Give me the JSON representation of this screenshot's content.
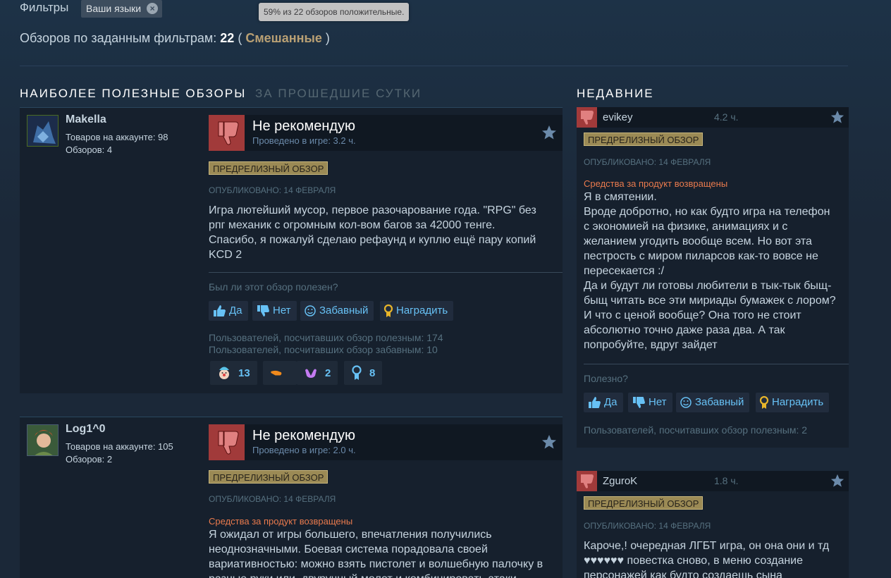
{
  "filters": {
    "label": "Фильтры",
    "chip_label": "Ваши языки",
    "chip_close_glyph": "×"
  },
  "tooltip": "59% из 22 обзоров положительные.",
  "summary": {
    "prefix": "Обзоров по заданным фильтрам:",
    "count": "22",
    "open_paren": "(",
    "rating": "Смешанные",
    "close_paren": ")"
  },
  "sections": {
    "helpful_title": "Наиболее полезные обзоры",
    "helpful_period": "за прошедшие сутки",
    "recent_title": "Недавние"
  },
  "colors": {
    "background": "#1b2838",
    "accent_link": "#67c1f5",
    "negative": "#a13a3a",
    "prerelease_badge": "#9b8a55",
    "refund_text": "#e97a4d",
    "mixed_rating": "#b9a074"
  },
  "reviews": [
    {
      "author": "Makella",
      "products": "Товаров на аккаунте: 98",
      "reviews_count": "Обзоров: 4",
      "verdict": "Не рекомендую",
      "hours": "Проведено в игре: 3.2 ч.",
      "badge": "Предрелизный обзор",
      "posted": "Опубликовано: 14 февраля",
      "text": [
        "Игра лютейший мусор, первое разочарование года. \"RPG\" без",
        "рпг механик с огромным кол-вом багов за 42000 тенге.",
        "Спасибо, я пожалуй сделаю рефаунд и куплю ещё пару копий",
        "KCD 2"
      ],
      "helpful_question": "Был ли этот обзор полезен?",
      "buttons": {
        "yes": "Да",
        "no": "Нет",
        "funny": "Забавный",
        "award": "Наградить"
      },
      "helpful_count": "Пользователей, посчитавших обзор полезным: 174",
      "funny_count": "Пользователей, посчитавших обзор забавным: 10",
      "awards": [
        {
          "icon": "clown-face-icon",
          "count": "13"
        },
        {
          "icon": "boot-icon",
          "count": ""
        },
        {
          "icon": "heart-hands-icon",
          "count": "2"
        },
        {
          "icon": "medal-icon",
          "count": "8"
        }
      ]
    },
    {
      "author": "Log1^0",
      "products": "Товаров на аккаунте: 105",
      "reviews_count": "Обзоров: 2",
      "verdict": "Не рекомендую",
      "hours": "Проведено в игре: 2.0 ч.",
      "badge": "Предрелизный обзор",
      "posted": "Опубликовано: 14 февраля",
      "refund": "Средства за продукт возвращены",
      "text": [
        "Я ожидал от игры большего, впечатления получились",
        "неоднозначными. Боевая система порадовала своей",
        "вариативностью: можно взять пистолет и волшебную палочку в",
        "разные руки или, двуручный молот и комбинировать атаки"
      ]
    }
  ],
  "recent": [
    {
      "author": "evikey",
      "hours": "4.2 ч.",
      "badge": "Предрелизный обзор",
      "posted": "Опубликовано: 14 февраля",
      "refund": "Средства за продукт возвращены",
      "text": [
        "Я в смятении.",
        "Вроде добротно, но как будто игра на телефон",
        "с экономией на физике, анимациях и с",
        "желанием угодить вообще всем. Но вот эта",
        "пестрость с миром пиларсов как-то вовсе не",
        "пересекается :/",
        "Да и будут ли готовы любители в тык-тык быщ-",
        "быщ читать все эти мириады бумажек с лором?",
        "И что с ценой вообще? Она того не стоит",
        "абсолютно точно даже раза два. А так",
        "попробуйте, вдруг зайдет"
      ],
      "helpful_question": "Полезно?",
      "buttons": {
        "yes": "Да",
        "no": "Нет",
        "funny": "Забавный",
        "award": "Наградить"
      },
      "helpful_count": "Пользователей, посчитавших обзор полезным: 2"
    },
    {
      "author": "ZguroK",
      "hours": "1.8 ч.",
      "badge": "Предрелизный обзор",
      "posted": "Опубликовано: 14 февраля",
      "text": [
        "Кароче,! очередная ЛГБТ игра, он она они и тд",
        "♥♥♥♥♥♥ повестка сново, в меню создание",
        "персонажей как будто создаешь сына"
      ]
    }
  ]
}
